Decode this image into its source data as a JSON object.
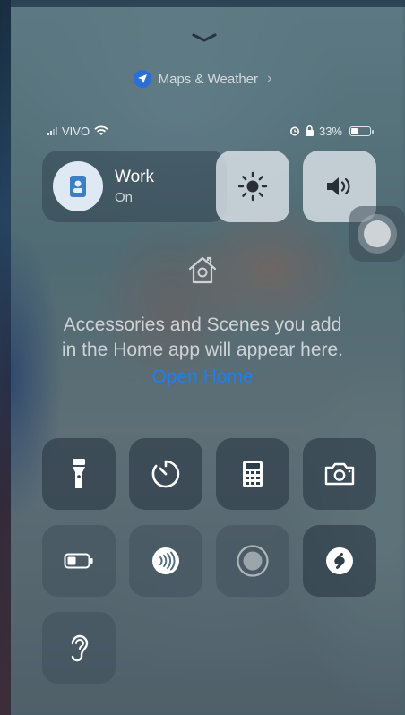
{
  "maps": {
    "label": "Maps & Weather",
    "chevron": "›"
  },
  "status": {
    "carrier": "VIVO",
    "battery_pct": "33%",
    "battery_level": 0.33
  },
  "focus": {
    "title": "Work",
    "state": "On"
  },
  "home": {
    "message": "Accessories and Scenes you add in the Home app will appear here.",
    "link": "Open Home"
  },
  "controls": [
    {
      "icon": "flashlight-icon"
    },
    {
      "icon": "timer-icon"
    },
    {
      "icon": "calculator-icon"
    },
    {
      "icon": "camera-icon"
    },
    {
      "icon": "low-power-mode-icon"
    },
    {
      "icon": "nfc-tap-icon"
    },
    {
      "icon": "screen-recording-icon"
    },
    {
      "icon": "shazam-icon"
    },
    {
      "icon": "hearing-icon"
    }
  ],
  "colors": {
    "accent_blue": "#1f7ff0",
    "nav_blue": "#2b6fd6"
  }
}
